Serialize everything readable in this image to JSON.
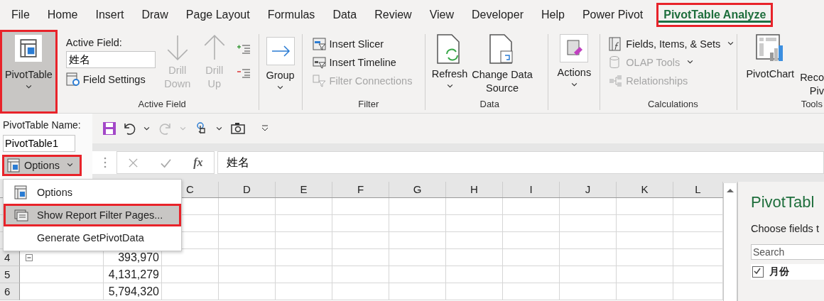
{
  "tabs": [
    {
      "label": "File",
      "selected": false,
      "highlighted": false
    },
    {
      "label": "Home",
      "selected": false,
      "highlighted": false
    },
    {
      "label": "Insert",
      "selected": false,
      "highlighted": false
    },
    {
      "label": "Draw",
      "selected": false,
      "highlighted": false
    },
    {
      "label": "Page Layout",
      "selected": false,
      "highlighted": false
    },
    {
      "label": "Formulas",
      "selected": false,
      "highlighted": false
    },
    {
      "label": "Data",
      "selected": false,
      "highlighted": false
    },
    {
      "label": "Review",
      "selected": false,
      "highlighted": false
    },
    {
      "label": "View",
      "selected": false,
      "highlighted": false
    },
    {
      "label": "Developer",
      "selected": false,
      "highlighted": false
    },
    {
      "label": "Help",
      "selected": false,
      "highlighted": false
    },
    {
      "label": "Power Pivot",
      "selected": false,
      "highlighted": false
    },
    {
      "label": "PivotTable Analyze",
      "selected": true,
      "highlighted": true
    }
  ],
  "ribbon": {
    "pivottable": {
      "label": "PivotTable",
      "highlighted": true
    },
    "active_field": {
      "title": "Active Field:",
      "value": "姓名",
      "field_settings": "Field Settings",
      "drill_down": {
        "label": "Drill Down",
        "disabled": true
      },
      "drill_up": {
        "label": "Drill Up",
        "disabled": true
      },
      "group_label": "Active Field"
    },
    "group": {
      "label": "Group"
    },
    "filter": {
      "items": [
        {
          "label": "Insert Slicer",
          "disabled": false
        },
        {
          "label": "Insert Timeline",
          "disabled": false
        },
        {
          "label": "Filter Connections",
          "disabled": true
        }
      ],
      "group_label": "Filter"
    },
    "data": {
      "refresh": "Refresh",
      "change_source": "Change Data Source",
      "group_label": "Data"
    },
    "actions": {
      "label": "Actions"
    },
    "calculations": {
      "items": [
        {
          "label": "Fields, Items, & Sets",
          "disabled": false,
          "dropdown": true
        },
        {
          "label": "OLAP Tools",
          "disabled": true,
          "dropdown": true
        },
        {
          "label": "Relationships",
          "disabled": true,
          "dropdown": false
        }
      ],
      "group_label": "Calculations"
    },
    "tools": {
      "pivotchart": "PivotChart",
      "recommended_lines": [
        "Reco",
        "Piv"
      ],
      "group_label": "Tools"
    }
  },
  "pivottable_panel": {
    "name_label": "PivotTable Name:",
    "name_value": "PivotTable1",
    "options_button": {
      "label": "Options",
      "highlighted": true
    }
  },
  "options_menu": [
    {
      "label": "Options",
      "selected": false,
      "highlighted": false
    },
    {
      "label": "Show Report Filter Pages...",
      "selected": true,
      "highlighted": true
    },
    {
      "label": "Generate GetPivotData",
      "selected": false,
      "highlighted": false
    }
  ],
  "quick_access": {
    "redo_disabled": true
  },
  "formula_bar": {
    "function_label": "fx",
    "value": "姓名"
  },
  "sheet": {
    "columns": [
      "C",
      "D",
      "E",
      "F",
      "G",
      "H",
      "I",
      "J",
      "K",
      "L"
    ],
    "rows": [
      {
        "number": "4",
        "value": "393,970",
        "collapsible": true
      },
      {
        "number": "5",
        "value": "4,131,279",
        "collapsible": false
      },
      {
        "number": "6",
        "value": "5,794,320",
        "collapsible": false
      }
    ]
  },
  "field_pane": {
    "title": "PivotTabl",
    "subtitle": "Choose fields t",
    "search_placeholder": "Search",
    "fields": [
      {
        "label": "月份",
        "checked": true
      }
    ]
  }
}
